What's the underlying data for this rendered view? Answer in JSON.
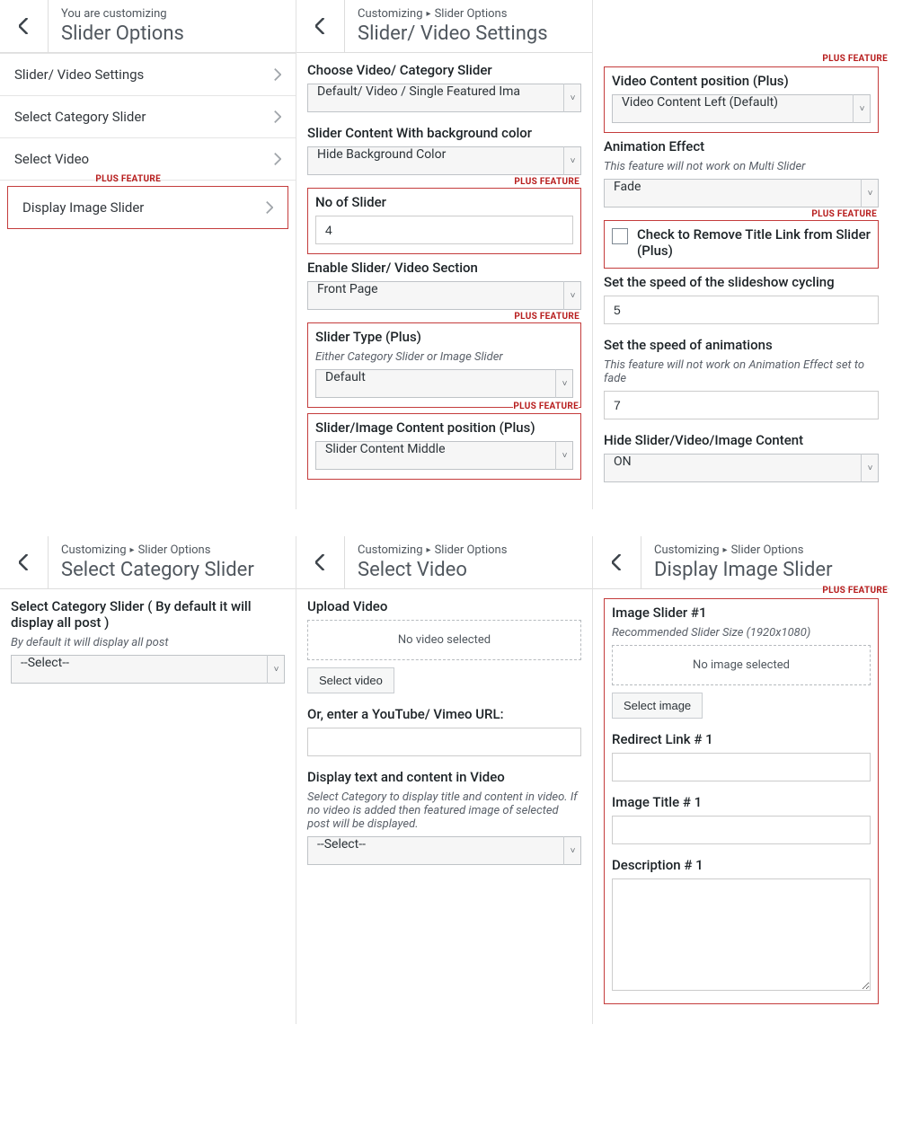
{
  "plus_feature": "PLUS FEATURE",
  "icons": {
    "chevron_left": "◀",
    "chevron_right": "▶",
    "caret": "˅"
  },
  "panel_a": {
    "crumb": "You are customizing",
    "title": "Slider Options",
    "menu": [
      "Slider/ Video Settings",
      "Select Category Slider",
      "Select Video",
      "Display Image Slider"
    ]
  },
  "panel_b": {
    "crumb_a": "Customizing",
    "crumb_b": "Slider Options",
    "title": "Slider/ Video Settings",
    "choose_label": "Choose Video/ Category Slider",
    "choose_value": "Default/ Video / Single Featured Ima",
    "bgcolor_label": "Slider Content With background color",
    "bgcolor_value": "Hide Background Color",
    "nslider_label": "No of Slider",
    "nslider_value": "4",
    "enable_label": "Enable Slider/ Video Section",
    "enable_value": "Front Page",
    "type_label": "Slider Type (Plus)",
    "type_desc": "Either Category Slider or Image Slider",
    "type_value": "Default",
    "pos_label": "Slider/Image Content position (Plus)",
    "pos_value": "Slider Content Middle"
  },
  "panel_c": {
    "vpos_label": "Video Content position (Plus)",
    "vpos_value": "Video Content Left (Default)",
    "anim_label": "Animation Effect",
    "anim_desc": "This feature will not work on Multi Slider",
    "anim_value": "Fade",
    "chk_label": "Check to Remove Title Link from Slider (Plus)",
    "speed1_label": "Set the speed of the slideshow cycling",
    "speed1_value": "5",
    "speed2_label": "Set the speed of animations",
    "speed2_desc": "This feature will not work on Animation Effect set to fade",
    "speed2_value": "7",
    "hide_label": "Hide Slider/Video/Image Content",
    "hide_value": "ON"
  },
  "panel_d": {
    "crumb_a": "Customizing",
    "crumb_b": "Slider Options",
    "title": "Select Category Slider",
    "sel_label": "Select Category Slider ( By default it will display all post )",
    "sel_desc": "By default it will display all post",
    "sel_value": "--Select--"
  },
  "panel_e": {
    "crumb_a": "Customizing",
    "crumb_b": "Slider Options",
    "title": "Select Video",
    "upload_label": "Upload Video",
    "empty": "No video selected",
    "btn": "Select video",
    "url_label": "Or, enter a YouTube/ Vimeo URL:",
    "disp_label": "Display text and content in Video",
    "disp_desc": "Select Category to display title and content in video. If no video is added then featured image of selected post will be displayed.",
    "disp_value": "--Select--"
  },
  "panel_f": {
    "crumb_a": "Customizing",
    "crumb_b": "Slider Options",
    "title": "Display Image Slider",
    "img_label": "Image Slider #1",
    "img_desc": "Recommended Slider Size (1920x1080)",
    "empty": "No image selected",
    "btn": "Select image",
    "redir_label": "Redirect Link # 1",
    "title_label": "Image Title # 1",
    "desc_label": "Description # 1"
  }
}
